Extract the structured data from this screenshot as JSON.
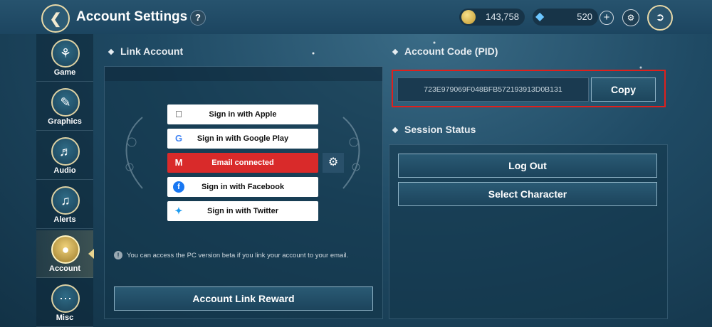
{
  "header": {
    "title": "Account Settings",
    "help": "?",
    "gold": "143,758",
    "gems": "520",
    "plus": "+"
  },
  "sidebar": {
    "items": [
      {
        "label": "Game",
        "icon": "gamepad-icon"
      },
      {
        "label": "Graphics",
        "icon": "palette-icon"
      },
      {
        "label": "Audio",
        "icon": "speaker-icon"
      },
      {
        "label": "Alerts",
        "icon": "bell-icon"
      },
      {
        "label": "Account",
        "icon": "user-icon"
      },
      {
        "label": "Misc",
        "icon": "ellipsis-icon"
      }
    ],
    "active": "Account"
  },
  "link_account": {
    "heading": "Link Account",
    "buttons": [
      {
        "label": "Sign in with Apple",
        "icon": "apple-icon"
      },
      {
        "label": "Sign in with Google Play",
        "icon": "google-icon"
      },
      {
        "label": "Email connected",
        "icon": "gmail-icon"
      },
      {
        "label": "Sign in with Facebook",
        "icon": "facebook-icon"
      },
      {
        "label": "Sign in with Twitter",
        "icon": "twitter-icon"
      }
    ],
    "info": "You can access the PC version beta if you link your account to your email.",
    "reward_button": "Account Link Reward"
  },
  "account_code": {
    "heading": "Account Code (PID)",
    "pid": "723E979069F048BFB572193913D0B131",
    "copy": "Copy"
  },
  "session": {
    "heading": "Session Status",
    "logout": "Log Out",
    "select_character": "Select Character"
  },
  "colors": {
    "highlight": "#e0201c",
    "email_connected": "#d92a2a"
  }
}
